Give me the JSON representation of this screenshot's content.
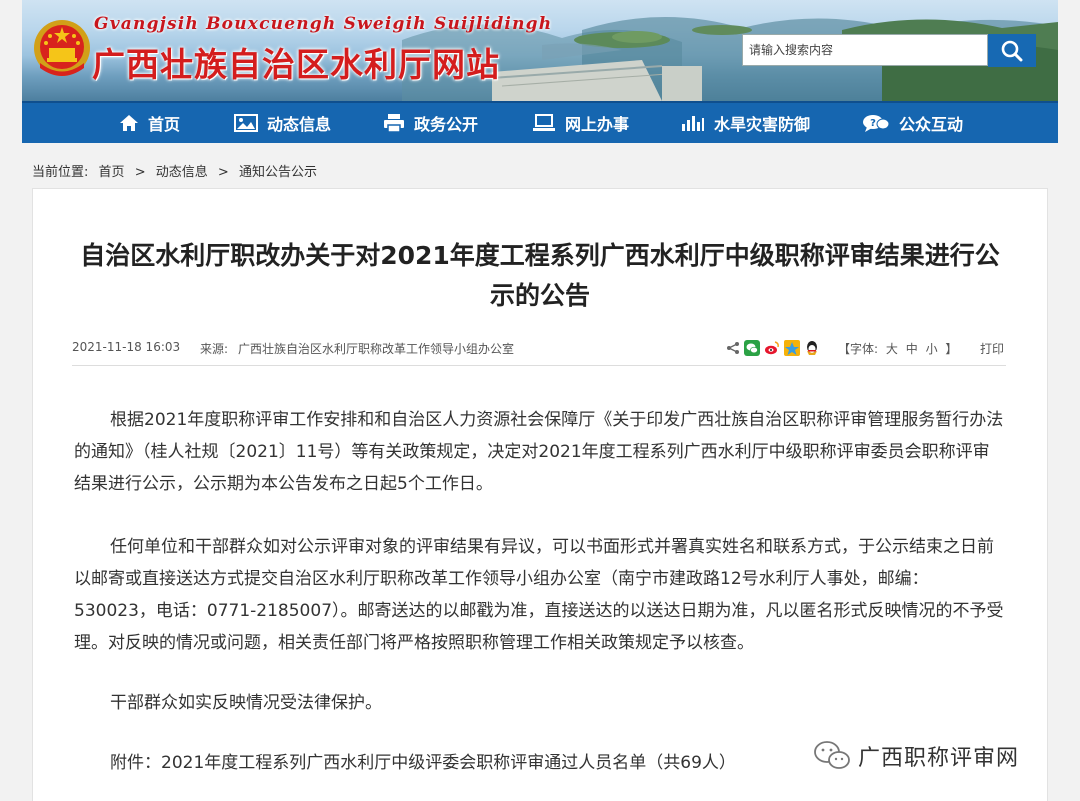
{
  "header": {
    "site_latin": "Gvangjsih Bouxcuengh Sweigih Suijlidingh",
    "site_title": "广西壮族自治区水利厅网站",
    "search_placeholder": "请输入搜索内容"
  },
  "nav": {
    "items": [
      {
        "label": "首页",
        "icon": "home-icon"
      },
      {
        "label": "动态信息",
        "icon": "image-icon"
      },
      {
        "label": "政务公开",
        "icon": "printer-icon"
      },
      {
        "label": "网上办事",
        "icon": "laptop-icon"
      },
      {
        "label": "水旱灾害防御",
        "icon": "bar-chart-icon"
      },
      {
        "label": "公众互动",
        "icon": "chat-icon"
      }
    ]
  },
  "breadcrumb": {
    "prefix": "当前位置:",
    "items": [
      "首页",
      "动态信息",
      "通知公告公示"
    ],
    "separator": ">"
  },
  "article": {
    "title": "自治区水利厅职改办关于对2021年度工程系列广西水利厅中级职称评审结果进行公示的公告",
    "date": "2021-11-18 16:03",
    "source_label": "来源:",
    "source": "广西壮族自治区水利厅职称改革工作领导小组办公室",
    "font_label_open": "【字体:",
    "font_large": "大",
    "font_medium": "中",
    "font_small": "小",
    "font_label_close": "】",
    "print_label": "打印",
    "paragraphs": [
      "根据2021年度职称评审工作安排和和自治区人力资源社会保障厅《关于印发广西壮族自治区职称评审管理服务暂行办法的通知》（桂人社规〔2021〕11号）等有关政策规定，决定对2021年度工程系列广西水利厅中级职称评审委员会职称评审结果进行公示，公示期为本公告发布之日起5个工作日。",
      "任何单位和干部群众如对公示评审对象的评审结果有异议，可以书面形式并署真实姓名和联系方式，于公示结束之日前以邮寄或直接送达方式提交自治区水利厅职称改革工作领导小组办公室（南宁市建政路12号水利厅人事处，邮编：530023，电话：0771-2185007）。邮寄送达的以邮戳为准，直接送达的以送达日期为准，凡以匿名形式反映情况的不予受理。对反映的情况或问题，相关责任部门将严格按照职称管理工作相关政策规定予以核查。",
      "干部群众如实反映情况受法律保护。",
      "附件：2021年度工程系列广西水利厅中级评委会职称评审通过人员名单（共69人）"
    ]
  },
  "watermark": {
    "text": "广西职称评审网"
  },
  "colors": {
    "nav_bg": "#1666b0",
    "title_red": "#d41d1d",
    "search_btn": "#1769b3"
  }
}
